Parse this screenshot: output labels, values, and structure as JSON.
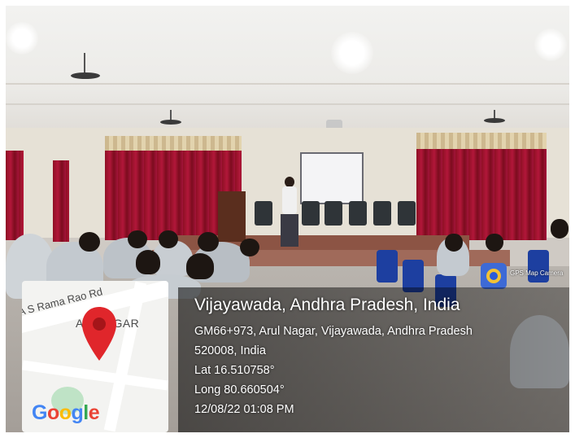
{
  "photo": {
    "description_scene": ""
  },
  "map": {
    "road_label": "A S Rama Rao Rd",
    "area_a": "A",
    "area_label": "NAGAR",
    "google_letters": [
      "G",
      "o",
      "o",
      "g",
      "l",
      "e"
    ],
    "google_colors": [
      "#4285F4",
      "#EA4335",
      "#FBBC05",
      "#4285F4",
      "#34A853",
      "#EA4335"
    ],
    "pin_color": "#e0262b",
    "pin-icon": "map-pin-icon"
  },
  "gps_app": {
    "label": "GPS Map Camera",
    "icon": "gps-camera-icon"
  },
  "location": {
    "title": "Vijayawada, Andhra Pradesh, India",
    "address_line1": "GM66+973, Arul Nagar, Vijayawada, Andhra Pradesh",
    "address_line2": "520008, India",
    "lat": "Lat 16.510758°",
    "long": "Long 80.660504°",
    "datetime": "12/08/22 01:08 PM"
  }
}
